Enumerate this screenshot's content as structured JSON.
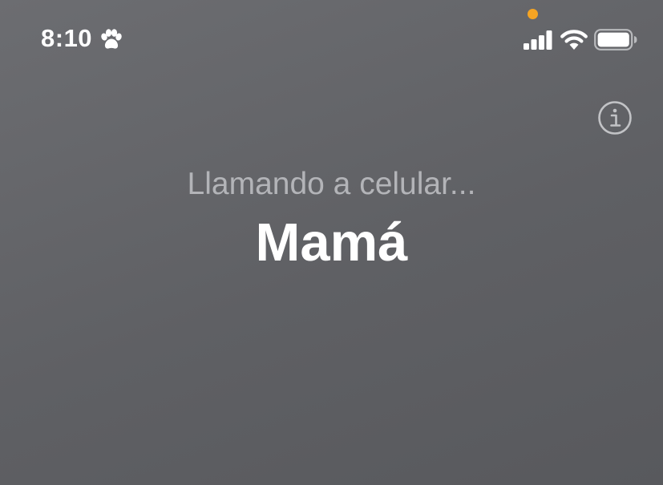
{
  "status_bar": {
    "time": "8:10",
    "focus_icon": "paw-icon",
    "privacy_indicator_color": "#f5a423",
    "signal_icon": "signal-bars-icon",
    "wifi_icon": "wifi-icon",
    "battery_icon": "battery-icon",
    "battery_level": 1.0
  },
  "call": {
    "status_text": "Llamando a celular...",
    "contact_name": "Mamá",
    "info_icon": "info-icon"
  },
  "colors": {
    "background": "#626367",
    "status_text": "#b3b4b8",
    "name_text": "#ffffff"
  }
}
